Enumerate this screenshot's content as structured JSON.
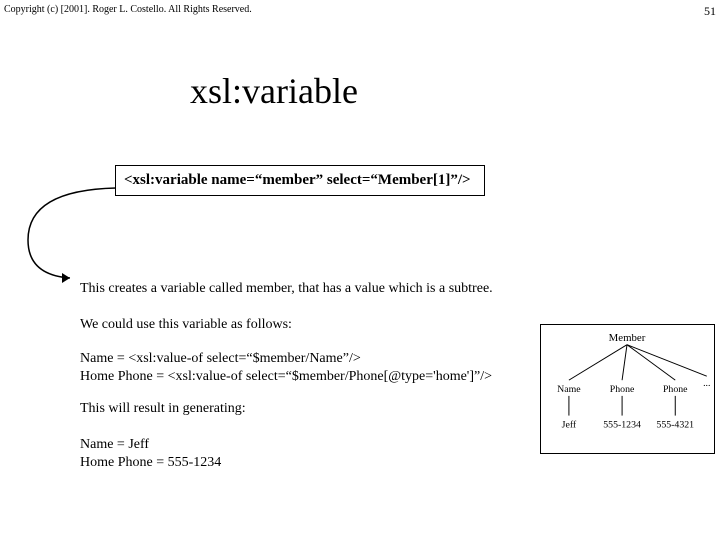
{
  "header": {
    "copyright": "Copyright (c) [2001].  Roger L. Costello.  All Rights Reserved.",
    "page_number": "51"
  },
  "title": "xsl:variable",
  "codebox": "<xsl:variable name=“member” select=“Member[1]”/>",
  "text": {
    "creates": "This creates a variable called member, that has a value which is a subtree.",
    "usage": "We could use this variable as follows:",
    "code1": "Name = <xsl:value-of select=“$member/Name”/>",
    "code2": "Home Phone = <xsl:value-of select=“$member/Phone[@type='home']”/>",
    "result_intro": "This will result in generating:",
    "result_name": "Name = Jeff",
    "result_home": "Home Phone = 555-1234"
  },
  "diagram": {
    "root": "Member",
    "level1": {
      "a": "Name",
      "b": "Phone",
      "c": "Phone"
    },
    "level2": {
      "a": "Jeff",
      "b": "555-1234",
      "c": "555-4321"
    },
    "ellipsis": "..."
  }
}
